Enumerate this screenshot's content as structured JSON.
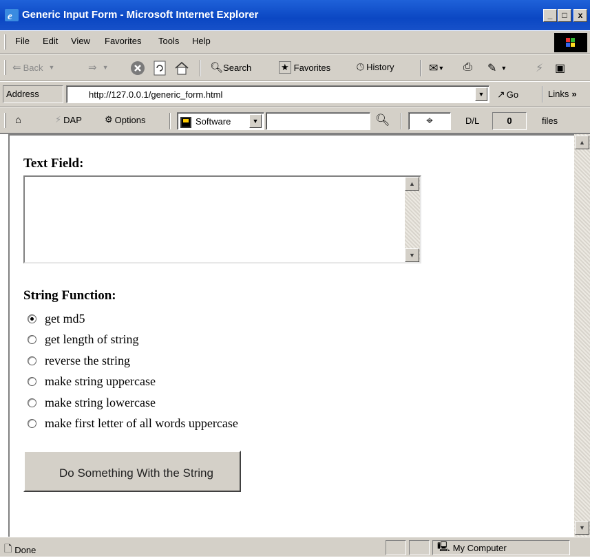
{
  "window": {
    "title": "Generic Input Form - Microsoft Internet Explorer",
    "controls": [
      "_",
      "□",
      "x"
    ]
  },
  "menu": {
    "items": [
      "File",
      "Edit",
      "View",
      "Favorites",
      "Tools",
      "Help"
    ]
  },
  "toolbar": {
    "back": "Back",
    "search": "Search",
    "favorites": "Favorites",
    "history": "History"
  },
  "address_bar": {
    "label": "Address",
    "url": "http://127.0.0.1/generic_form.html",
    "go": "Go",
    "links": "Links"
  },
  "extra_toolbar": {
    "dap": "DAP",
    "options": "Options",
    "select_value": "Software",
    "dl_label": "D/L",
    "dl_count": "0",
    "files_label": "files"
  },
  "form": {
    "text_field_label": "Text Field:",
    "text_field_value": "",
    "string_function_label": "String Function:",
    "options": [
      {
        "label": "get md5",
        "checked": true
      },
      {
        "label": "get length of string",
        "checked": false
      },
      {
        "label": "reverse the string",
        "checked": false
      },
      {
        "label": "make string uppercase",
        "checked": false
      },
      {
        "label": "make string lowercase",
        "checked": false
      },
      {
        "label": "make first letter of all words uppercase",
        "checked": false
      }
    ],
    "submit_label": "Do Something With the String"
  },
  "status_bar": {
    "status": "Done",
    "zone": "My Computer"
  },
  "colors": {
    "title_bar": "#0b47c3",
    "chrome": "#d4d0c8"
  }
}
